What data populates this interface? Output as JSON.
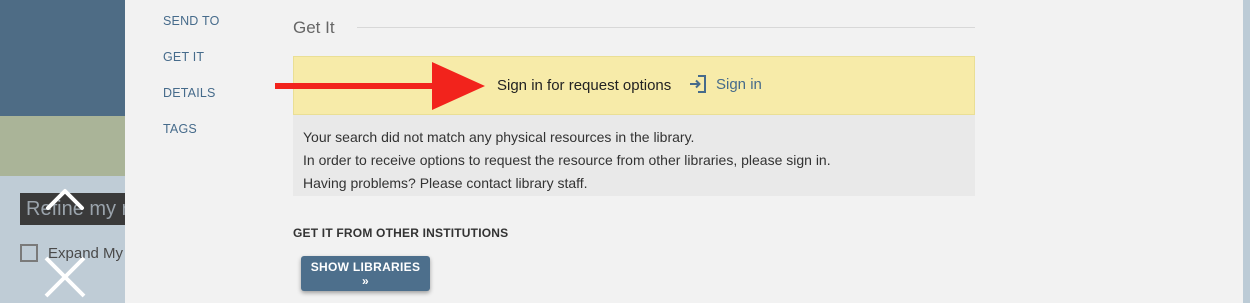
{
  "background": {
    "refine_text": "Refine my re",
    "expand_label": "Expand My"
  },
  "side_nav": {
    "items": [
      {
        "label": "SEND TO"
      },
      {
        "label": "GET IT"
      },
      {
        "label": "DETAILS"
      },
      {
        "label": "TAGS"
      }
    ]
  },
  "get_it": {
    "title": "Get It",
    "signin_prompt": "Sign in for request options",
    "signin_link": "Sign in",
    "messages": [
      "Your search did not match any physical resources in the library.",
      "In order to receive options to request the resource from other libraries, please sign in.",
      "Having problems? Please contact library staff."
    ],
    "other_institutions_heading": "GET IT FROM OTHER INSTITUTIONS",
    "show_libraries_button": "SHOW LIBRARIES »"
  },
  "icons": {
    "nav_up": "chevron-up-icon",
    "close": "close-icon",
    "sign_in": "sign-in-icon",
    "annotation": "red-arrow-annotation"
  },
  "colors": {
    "link": "#466b8b",
    "banner": "#f7eba9",
    "button": "#4d6f8c",
    "arrow": "#f2231c"
  }
}
